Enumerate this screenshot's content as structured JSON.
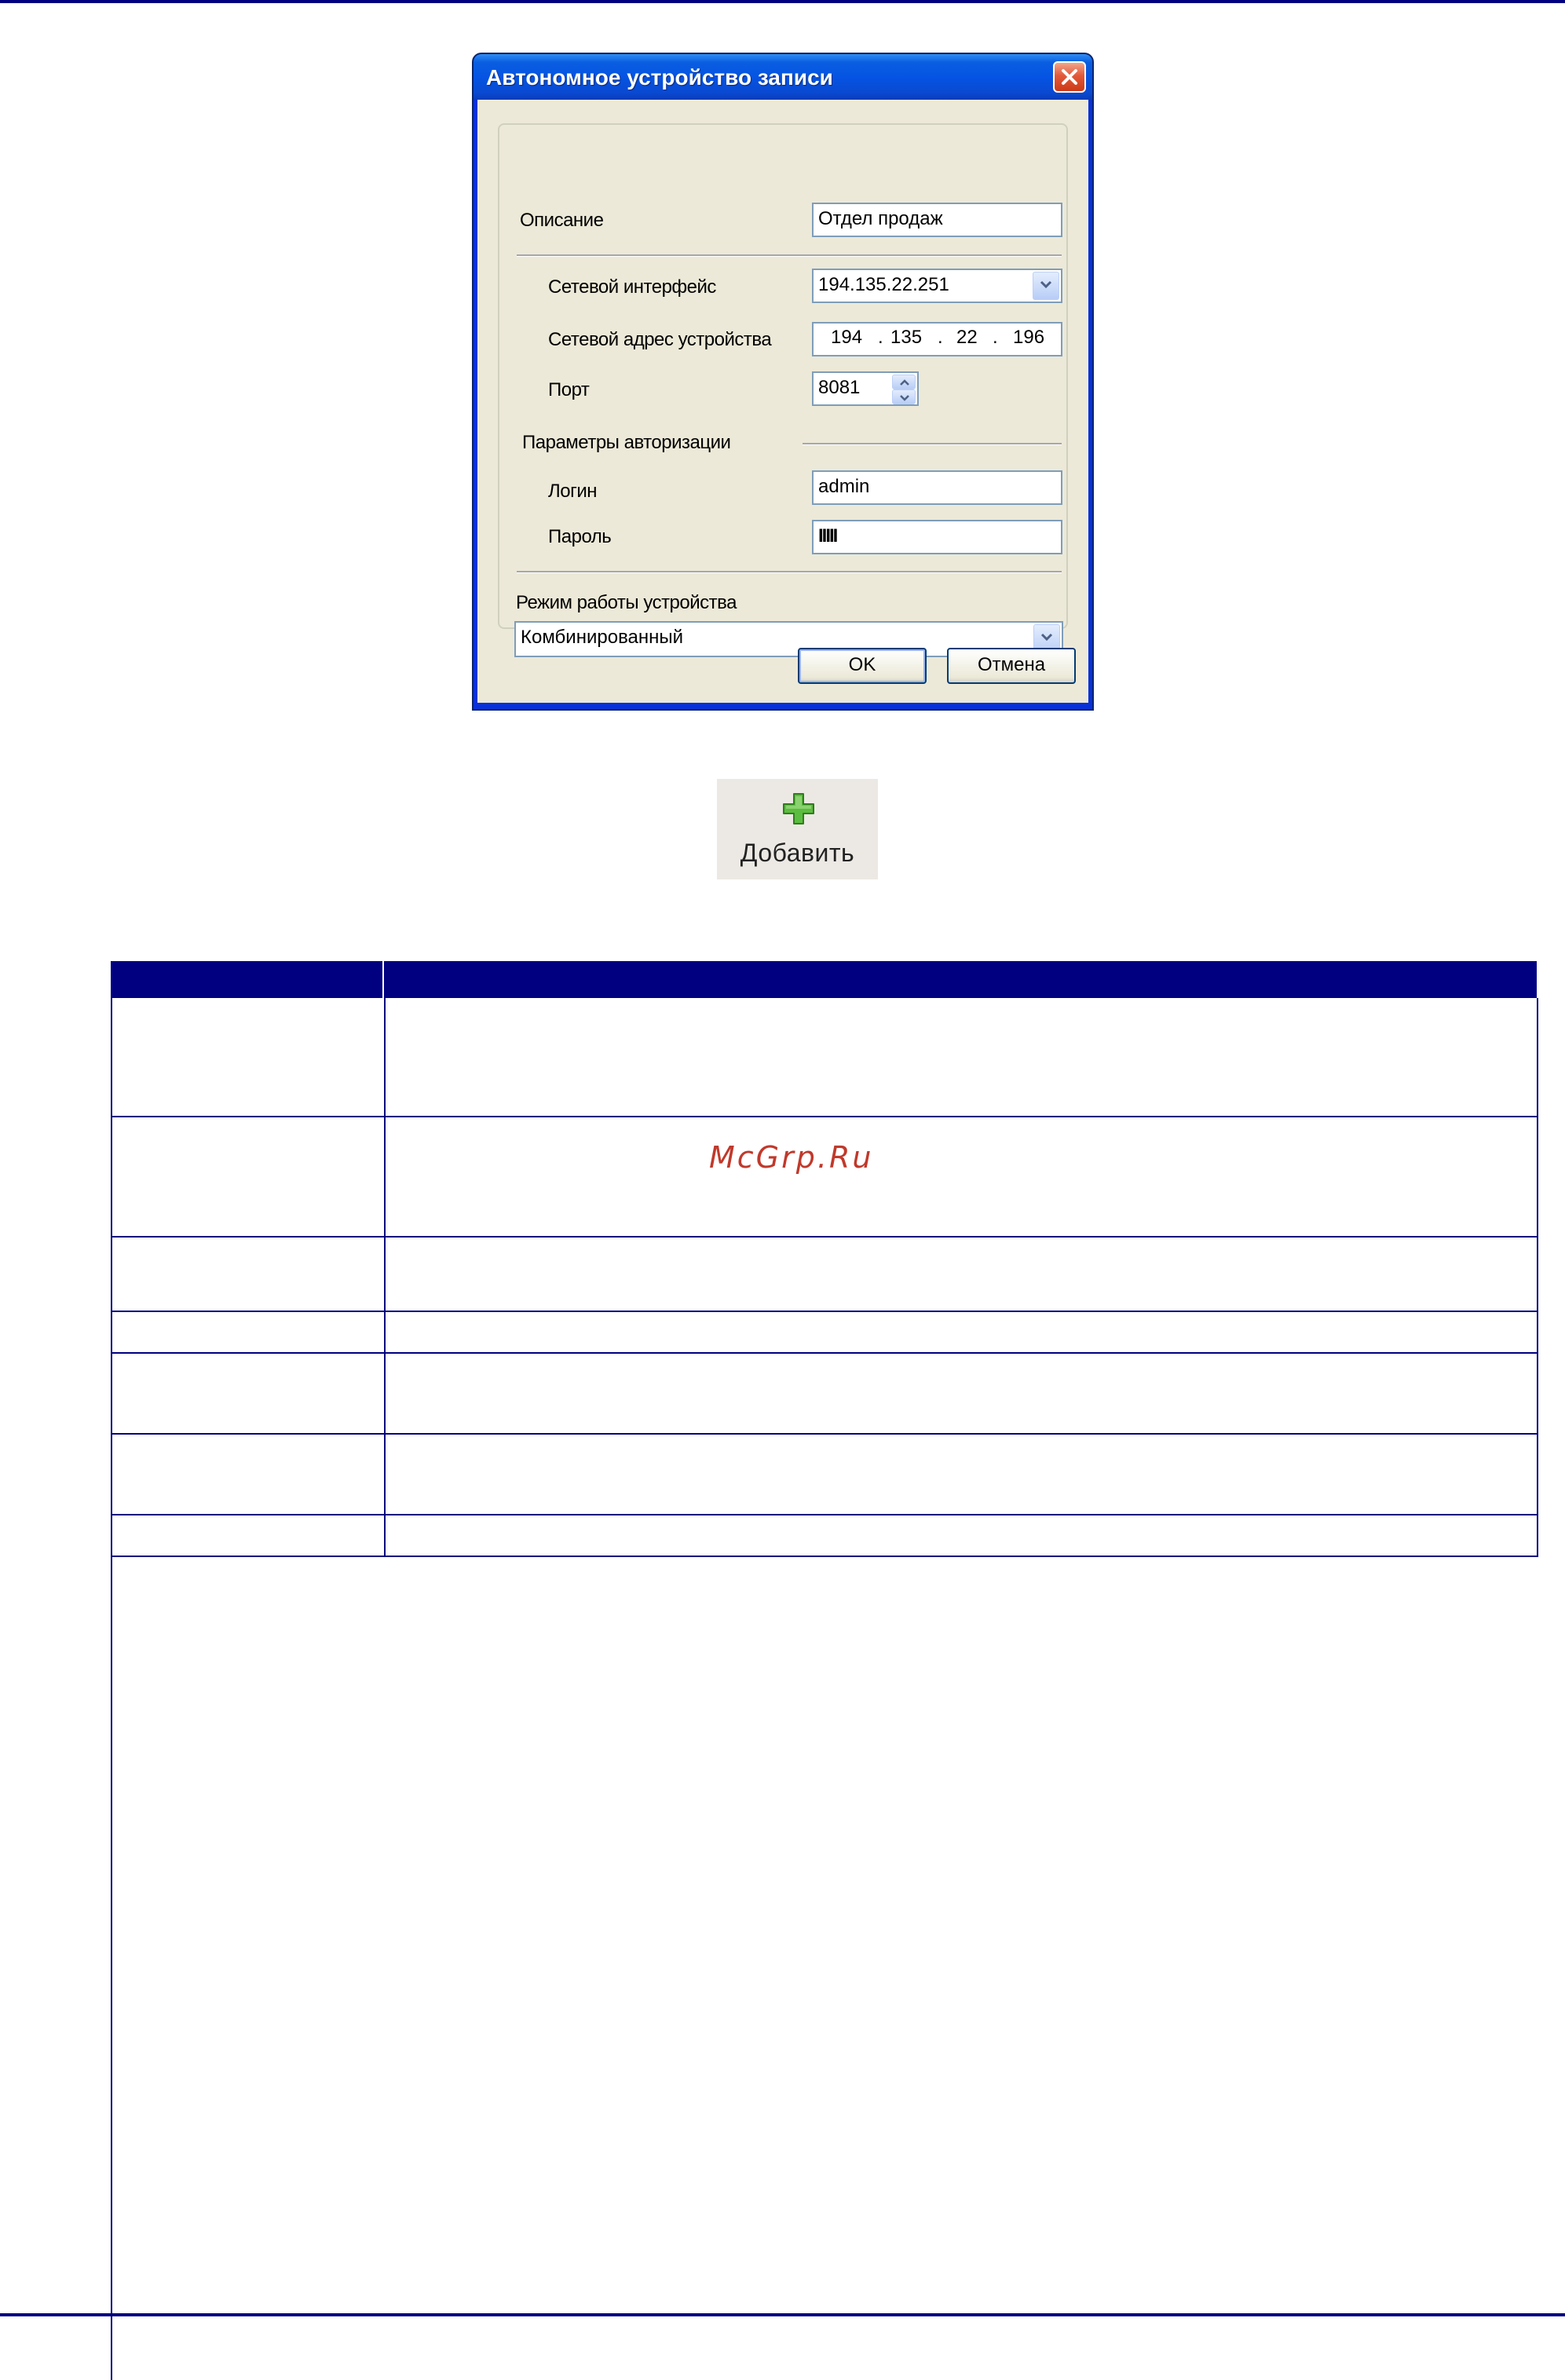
{
  "dialog": {
    "title": "Автономное устройство записи",
    "description_label": "Описание",
    "description_value": "Отдел продаж",
    "network_interface_label": "Сетевой интерфейс",
    "network_interface_value": "194.135.22.251",
    "device_address_label": "Сетевой адрес устройства",
    "device_address_octets": [
      "194",
      "135",
      "22",
      "196"
    ],
    "port_label": "Порт",
    "port_value": "8081",
    "auth_group_label": "Параметры авторизации",
    "login_label": "Логин",
    "login_value": "admin",
    "password_label": "Пароль",
    "password_mask": "IIIII",
    "mode_label": "Режим работы устройства",
    "mode_value": "Комбинированный",
    "ok_label": "OK",
    "cancel_label": "Отмена"
  },
  "toolbar": {
    "add_label": "Добавить",
    "add_icon": "plus-icon"
  },
  "watermark": "McGrp.Ru",
  "colors": {
    "rule": "#000080",
    "table_header": "#000080",
    "dialog_face": "#ece9d8",
    "titlebar": "#0554e3",
    "plus": "#5bbd3f"
  }
}
